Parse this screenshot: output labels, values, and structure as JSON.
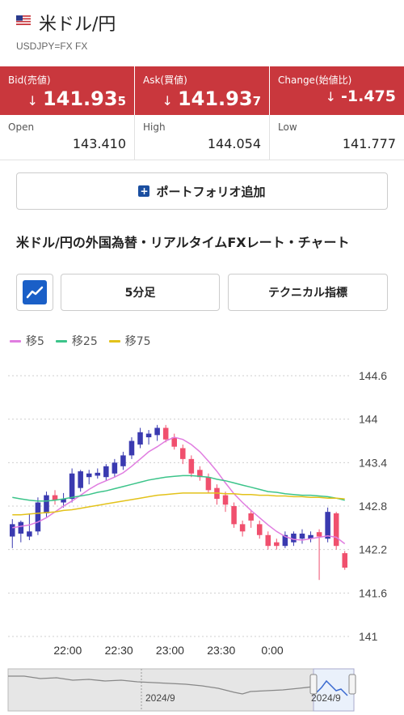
{
  "header": {
    "title": "米ドル/円",
    "subtitle": "USDJPY=FX FX",
    "flag_icon": "us-flag-icon"
  },
  "quotes": {
    "bid": {
      "label": "Bid(売値)",
      "value_main": "141.93",
      "value_last": "5",
      "arrow": "↓"
    },
    "ask": {
      "label": "Ask(買値)",
      "value_main": "141.93",
      "value_last": "7",
      "arrow": "↓"
    },
    "change": {
      "label": "Change(始値比)",
      "value": "-1.475",
      "arrow": "↓"
    },
    "background_color": "#c9373d"
  },
  "stats": {
    "open": {
      "label": "Open",
      "value": "143.410"
    },
    "high": {
      "label": "High",
      "value": "144.054"
    },
    "low": {
      "label": "Low",
      "value": "141.777"
    }
  },
  "portfolio_button": {
    "label": "ポートフォリオ追加",
    "icon": "plus-icon"
  },
  "section_title": "米ドル/円の外国為替・リアルタイムFXレート・チャート",
  "toolbar": {
    "chart_type_icon": "line-chart-icon",
    "interval_label": "5分足",
    "technical_label": "テクニカル指標"
  },
  "legend": [
    {
      "label": "移5",
      "color": "#e07de0"
    },
    {
      "label": "移25",
      "color": "#3cc48a"
    },
    {
      "label": "移75",
      "color": "#e3c21a"
    }
  ],
  "navigator": {
    "labels": [
      "2024/9",
      "2024/9"
    ]
  },
  "chart_data": {
    "type": "candlestick",
    "up_color": "#3a3ab0",
    "down_color": "#f0506e",
    "ylim": [
      141,
      144.6
    ],
    "yticks": [
      144.6,
      144,
      143.4,
      142.8,
      142.2,
      141.6,
      141
    ],
    "xticks": [
      {
        "label": "22:00",
        "index": 6.5
      },
      {
        "label": "22:30",
        "index": 12.5
      },
      {
        "label": "23:00",
        "index": 18.5
      },
      {
        "label": "23:30",
        "index": 24.5
      },
      {
        "label": "0:00",
        "index": 30.5
      }
    ],
    "candles": [
      {
        "o": 142.38,
        "h": 142.62,
        "l": 142.22,
        "c": 142.55
      },
      {
        "o": 142.42,
        "h": 142.6,
        "l": 142.3,
        "c": 142.58
      },
      {
        "o": 142.38,
        "h": 142.7,
        "l": 142.33,
        "c": 142.45
      },
      {
        "o": 142.45,
        "h": 142.92,
        "l": 142.4,
        "c": 142.85
      },
      {
        "o": 142.7,
        "h": 143.0,
        "l": 142.65,
        "c": 142.95
      },
      {
        "o": 142.95,
        "h": 143.02,
        "l": 142.82,
        "c": 142.88
      },
      {
        "o": 142.85,
        "h": 142.98,
        "l": 142.78,
        "c": 142.9
      },
      {
        "o": 142.9,
        "h": 143.32,
        "l": 142.85,
        "c": 143.25
      },
      {
        "o": 143.05,
        "h": 143.3,
        "l": 143.0,
        "c": 143.28
      },
      {
        "o": 143.2,
        "h": 143.3,
        "l": 143.1,
        "c": 143.25
      },
      {
        "o": 143.22,
        "h": 143.32,
        "l": 143.18,
        "c": 143.26
      },
      {
        "o": 143.2,
        "h": 143.38,
        "l": 143.15,
        "c": 143.35
      },
      {
        "o": 143.25,
        "h": 143.45,
        "l": 143.2,
        "c": 143.4
      },
      {
        "o": 143.35,
        "h": 143.55,
        "l": 143.3,
        "c": 143.5
      },
      {
        "o": 143.5,
        "h": 143.75,
        "l": 143.45,
        "c": 143.7
      },
      {
        "o": 143.65,
        "h": 143.88,
        "l": 143.6,
        "c": 143.82
      },
      {
        "o": 143.75,
        "h": 143.85,
        "l": 143.65,
        "c": 143.8
      },
      {
        "o": 143.78,
        "h": 143.92,
        "l": 143.7,
        "c": 143.88
      },
      {
        "o": 143.88,
        "h": 143.92,
        "l": 143.68,
        "c": 143.72
      },
      {
        "o": 143.75,
        "h": 143.8,
        "l": 143.58,
        "c": 143.62
      },
      {
        "o": 143.6,
        "h": 143.65,
        "l": 143.38,
        "c": 143.45
      },
      {
        "o": 143.45,
        "h": 143.5,
        "l": 143.2,
        "c": 143.25
      },
      {
        "o": 143.3,
        "h": 143.35,
        "l": 143.15,
        "c": 143.2
      },
      {
        "o": 143.2,
        "h": 143.25,
        "l": 142.98,
        "c": 143.02
      },
      {
        "o": 143.05,
        "h": 143.1,
        "l": 142.82,
        "c": 142.9
      },
      {
        "o": 142.95,
        "h": 143.0,
        "l": 142.72,
        "c": 142.82
      },
      {
        "o": 142.8,
        "h": 142.85,
        "l": 142.5,
        "c": 142.55
      },
      {
        "o": 142.55,
        "h": 142.6,
        "l": 142.38,
        "c": 142.45
      },
      {
        "o": 142.7,
        "h": 142.75,
        "l": 142.5,
        "c": 142.6
      },
      {
        "o": 142.55,
        "h": 142.6,
        "l": 142.35,
        "c": 142.4
      },
      {
        "o": 142.4,
        "h": 142.45,
        "l": 142.2,
        "c": 142.25
      },
      {
        "o": 142.3,
        "h": 142.35,
        "l": 142.2,
        "c": 142.25
      },
      {
        "o": 142.25,
        "h": 142.45,
        "l": 142.22,
        "c": 142.4
      },
      {
        "o": 142.3,
        "h": 142.45,
        "l": 142.25,
        "c": 142.42
      },
      {
        "o": 142.35,
        "h": 142.48,
        "l": 142.28,
        "c": 142.42
      },
      {
        "o": 142.35,
        "h": 142.45,
        "l": 142.3,
        "c": 142.4
      },
      {
        "o": 142.44,
        "h": 142.48,
        "l": 141.78,
        "c": 142.38
      },
      {
        "o": 142.35,
        "h": 142.78,
        "l": 142.3,
        "c": 142.72
      },
      {
        "o": 142.7,
        "h": 142.72,
        "l": 142.2,
        "c": 142.25
      },
      {
        "o": 142.15,
        "h": 142.18,
        "l": 141.92,
        "c": 141.95
      }
    ],
    "ma_series": [
      {
        "name": "移5",
        "color": "#e07de0",
        "values": [
          142.5,
          142.52,
          142.54,
          142.58,
          142.64,
          142.72,
          142.8,
          142.87,
          142.95,
          143.03,
          143.1,
          143.15,
          143.2,
          143.26,
          143.35,
          143.45,
          143.55,
          143.62,
          143.7,
          143.75,
          143.72,
          143.65,
          143.55,
          143.42,
          143.28,
          143.12,
          142.97,
          142.85,
          142.74,
          142.64,
          142.54,
          142.45,
          142.38,
          142.34,
          142.33,
          142.35,
          142.37,
          142.39,
          142.37,
          142.28
        ]
      },
      {
        "name": "移25",
        "color": "#3cc48a",
        "values": [
          142.92,
          142.9,
          142.88,
          142.87,
          142.87,
          142.88,
          142.9,
          142.92,
          142.94,
          142.96,
          142.99,
          143.01,
          143.04,
          143.07,
          143.1,
          143.13,
          143.16,
          143.18,
          143.2,
          143.21,
          143.22,
          143.22,
          143.21,
          143.2,
          143.17,
          143.15,
          143.12,
          143.09,
          143.06,
          143.03,
          143.0,
          142.99,
          142.97,
          142.96,
          142.95,
          142.95,
          142.94,
          142.93,
          142.91,
          142.88
        ]
      },
      {
        "name": "移75",
        "color": "#e3c21a",
        "values": [
          142.68,
          142.68,
          142.69,
          142.7,
          142.71,
          142.72,
          142.74,
          142.75,
          142.77,
          142.79,
          142.81,
          142.83,
          142.85,
          142.87,
          142.89,
          142.91,
          142.93,
          142.95,
          142.96,
          142.97,
          142.98,
          142.98,
          142.98,
          142.98,
          142.98,
          142.97,
          142.97,
          142.96,
          142.96,
          142.95,
          142.95,
          142.94,
          142.94,
          142.93,
          142.93,
          142.92,
          142.92,
          142.91,
          142.91,
          142.9
        ]
      }
    ]
  }
}
